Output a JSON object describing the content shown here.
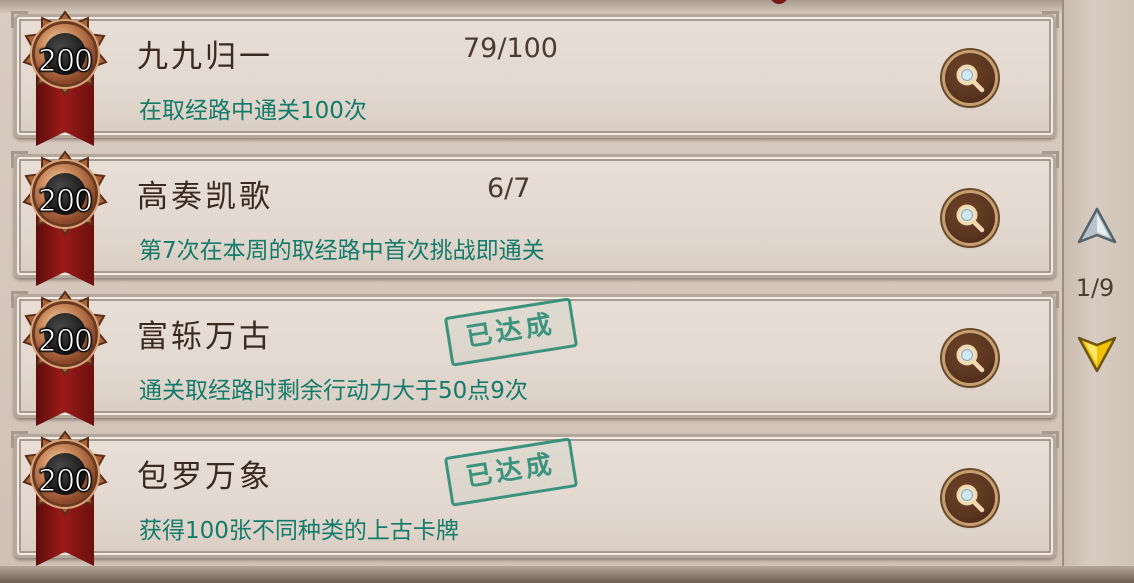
{
  "achievements": [
    {
      "points": "200",
      "title": "九九归一",
      "progress": "79/100",
      "description": "在取经路中通关100次",
      "completed": false,
      "completed_stamp": "",
      "action_icon": "search-icon"
    },
    {
      "points": "200",
      "title": "高奏凯歌",
      "progress": "6/7",
      "description": "第7次在本周的取经路中首次挑战即通关",
      "completed": false,
      "completed_stamp": "",
      "action_icon": "search-icon"
    },
    {
      "points": "200",
      "title": "富轹万古",
      "progress": "",
      "description": "通关取经路时剩余行动力大于50点9次",
      "completed": true,
      "completed_stamp": "已达成",
      "action_icon": "search-icon"
    },
    {
      "points": "200",
      "title": "包罗万象",
      "progress": "",
      "description": "获得100张不同种类的上古卡牌",
      "completed": true,
      "completed_stamp": "已达成",
      "action_icon": "search-icon"
    }
  ],
  "pagination": {
    "current": "1/9",
    "up_icon": "arrow-up-icon",
    "down_icon": "arrow-down-icon"
  },
  "colors": {
    "description_text": "#137b6a",
    "stamp": "#2e8d76",
    "ribbon": "#9b1b18",
    "down_arrow": "#f2c200"
  }
}
